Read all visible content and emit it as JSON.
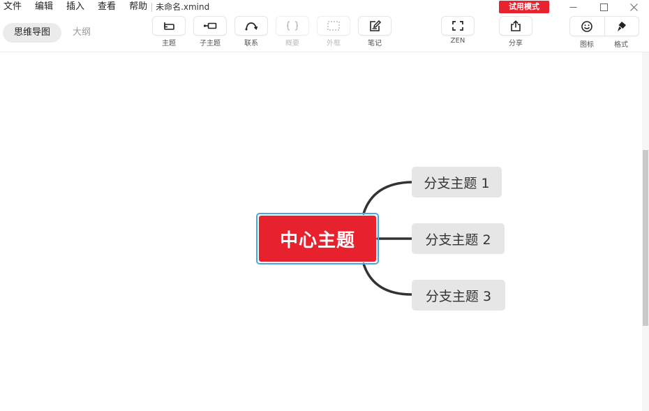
{
  "menu": {
    "items": [
      "文件",
      "编辑",
      "插入",
      "查看",
      "帮助"
    ],
    "filename": "未命名.xmind",
    "trial_badge": "试用模式"
  },
  "mode_tabs": {
    "mindmap": "思维导图",
    "outline": "大纲"
  },
  "toolbar": {
    "topic": "主题",
    "subtopic": "子主题",
    "relationship": "联系",
    "summary": "概要",
    "boundary": "外框",
    "note": "笔记",
    "zen": "ZEN",
    "share": "分享",
    "icon": "图标",
    "format": "格式"
  },
  "mindmap": {
    "central_topic": "中心主题",
    "branches": [
      "分支主题 1",
      "分支主题 2",
      "分支主题 3"
    ]
  },
  "colors": {
    "central_fill": "#e8212f",
    "selection": "#4aa7e6",
    "branch_fill": "#e6e6e6",
    "trial_badge": "#e8232f",
    "connector": "#333333"
  }
}
